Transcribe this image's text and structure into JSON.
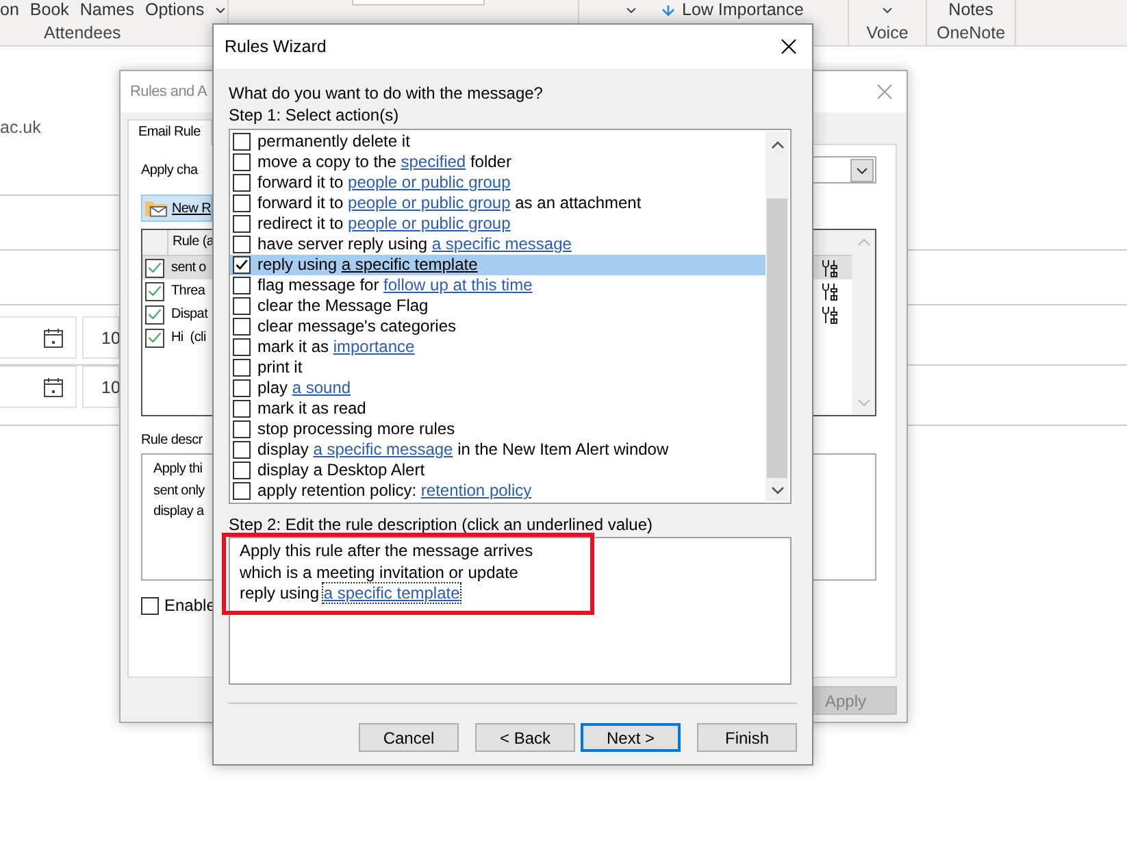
{
  "ribbon": {
    "top_labels": [
      "on",
      "Book",
      "Names",
      "Options"
    ],
    "group_label": "Attendees",
    "importance": "Low Importance",
    "notes": "Notes",
    "voice": "Voice",
    "onenote": "OneNote"
  },
  "background": {
    "email_fragment": "ac.uk",
    "time_fields": [
      "10",
      "10"
    ]
  },
  "rules_dialog": {
    "title": "Rules and A",
    "tab": "Email Rule",
    "apply_label": "Apply cha",
    "new_button": "New R",
    "column_header": "Rule (a",
    "rules": [
      {
        "name": "sent o",
        "checked": true,
        "selected": true,
        "has_icon": true
      },
      {
        "name": "Threa",
        "checked": true,
        "selected": false,
        "has_icon": true
      },
      {
        "name": "Dispat",
        "checked": true,
        "selected": false,
        "has_icon": true
      },
      {
        "name": "Hi  (cli",
        "checked": true,
        "selected": false,
        "has_icon": false
      }
    ],
    "description_label": "Rule descr",
    "description_lines": [
      "Apply thi",
      "sent only",
      "display a"
    ],
    "enable_label": "Enable",
    "enable_checked": false,
    "apply_button": "Apply",
    "apply_disabled": true
  },
  "wizard": {
    "title": "Rules Wizard",
    "question": "What do you want to do with the message?",
    "step1": "Step 1: Select action(s)",
    "actions": [
      {
        "text": "permanently delete it",
        "checked": false,
        "selected": false
      },
      {
        "text": "move a copy to the ",
        "link": "specified",
        "after": " folder",
        "checked": false,
        "selected": false
      },
      {
        "text": "forward it to ",
        "link": "people or public group",
        "checked": false,
        "selected": false
      },
      {
        "text": "forward it to ",
        "link": "people or public group",
        "after": " as an attachment",
        "checked": false,
        "selected": false
      },
      {
        "text": "redirect it to ",
        "link": "people or public group",
        "checked": false,
        "selected": false
      },
      {
        "text": "have server reply using ",
        "link": "a specific message",
        "checked": false,
        "selected": false
      },
      {
        "text": "reply using ",
        "link": "a specific template",
        "checked": true,
        "selected": true
      },
      {
        "text": "flag message for ",
        "link": "follow up at this time",
        "checked": false,
        "selected": false
      },
      {
        "text": "clear the Message Flag",
        "checked": false,
        "selected": false
      },
      {
        "text": "clear message's categories",
        "checked": false,
        "selected": false
      },
      {
        "text": "mark it as ",
        "link": "importance",
        "checked": false,
        "selected": false
      },
      {
        "text": "print it",
        "checked": false,
        "selected": false
      },
      {
        "text": "play ",
        "link": "a sound",
        "checked": false,
        "selected": false
      },
      {
        "text": "mark it as read",
        "checked": false,
        "selected": false
      },
      {
        "text": "stop processing more rules",
        "checked": false,
        "selected": false
      },
      {
        "text": "display ",
        "link": "a specific message",
        "after": " in the New Item Alert window",
        "checked": false,
        "selected": false
      },
      {
        "text": "display a Desktop Alert",
        "checked": false,
        "selected": false
      },
      {
        "text": "apply retention policy: ",
        "link": "retention policy",
        "checked": false,
        "selected": false
      }
    ],
    "step2": "Step 2: Edit the rule description (click an underlined value)",
    "description": [
      {
        "text": "Apply this rule after the message arrives"
      },
      {
        "text": "which is a meeting invitation or update"
      },
      {
        "text": "reply using ",
        "link": "a specific template"
      }
    ],
    "description_highlighted": true,
    "buttons": [
      {
        "label": "Cancel",
        "default": false
      },
      {
        "label": "< Back",
        "default": false
      },
      {
        "label": "Next >",
        "default": true
      },
      {
        "label": "Finish",
        "default": false
      }
    ]
  }
}
